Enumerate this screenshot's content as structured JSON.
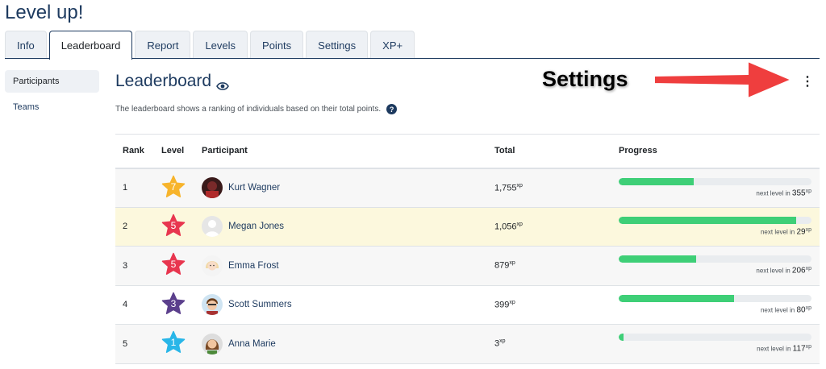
{
  "app": {
    "title": "Level up!"
  },
  "tabs": [
    {
      "label": "Info",
      "active": false
    },
    {
      "label": "Leaderboard",
      "active": true
    },
    {
      "label": "Report",
      "active": false
    },
    {
      "label": "Levels",
      "active": false
    },
    {
      "label": "Points",
      "active": false
    },
    {
      "label": "Settings",
      "active": false
    },
    {
      "label": "XP+",
      "active": false
    }
  ],
  "sidebar": {
    "items": [
      {
        "label": "Participants",
        "active": true
      },
      {
        "label": "Teams",
        "active": false
      }
    ]
  },
  "main": {
    "title": "Leaderboard",
    "title_icon": "eye-icon",
    "description": "The leaderboard shows a ranking of individuals based on their total points.",
    "help_icon": "?",
    "menu_icon": "⋮"
  },
  "annotation": {
    "label": "Settings",
    "arrow_color": "#ef3e3e"
  },
  "table": {
    "headers": {
      "rank": "Rank",
      "level": "Level",
      "participant": "Participant",
      "total": "Total",
      "progress": "Progress"
    },
    "xp_unit": "xp",
    "next_level_text": "next level in",
    "rows": [
      {
        "rank": "1",
        "level": "7",
        "star_color": "#f7b42c",
        "name": "Kurt Wagner",
        "total": "1,755",
        "next": "355",
        "progress": 0.39,
        "avatar": "dark",
        "highlight": false
      },
      {
        "rank": "2",
        "level": "5",
        "star_color": "#e8364f",
        "name": "Megan Jones",
        "total": "1,056",
        "next": "29",
        "progress": 0.92,
        "avatar": "blank",
        "highlight": true
      },
      {
        "rank": "3",
        "level": "5",
        "star_color": "#e8364f",
        "name": "Emma Frost",
        "total": "879",
        "next": "206",
        "progress": 0.4,
        "avatar": "blonde",
        "highlight": false
      },
      {
        "rank": "4",
        "level": "3",
        "star_color": "#5b3f8c",
        "name": "Scott Summers",
        "total": "399",
        "next": "80",
        "progress": 0.6,
        "avatar": "brown",
        "highlight": false
      },
      {
        "rank": "5",
        "level": "1",
        "star_color": "#29b6e8",
        "name": "Anna Marie",
        "total": "3",
        "next": "117",
        "progress": 0.025,
        "avatar": "girl",
        "highlight": false
      }
    ]
  }
}
